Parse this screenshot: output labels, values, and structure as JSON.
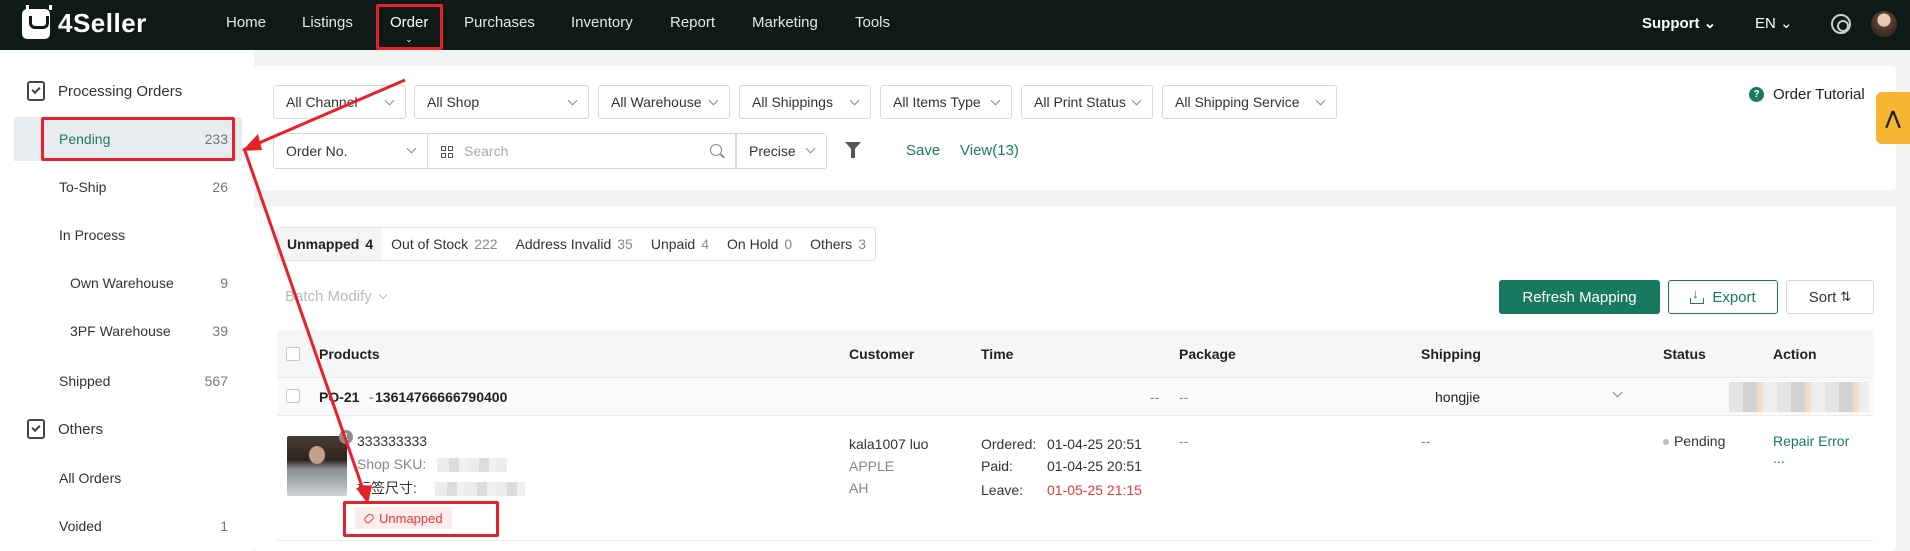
{
  "app": {
    "brand": "4Seller"
  },
  "topnav": {
    "items": [
      "Home",
      "Listings",
      "Order",
      "Purchases",
      "Inventory",
      "Report",
      "Marketing",
      "Tools"
    ],
    "support": "Support",
    "language": "EN"
  },
  "sidebar": {
    "processing_title": "Processing Orders",
    "items": [
      {
        "label": "Pending",
        "count": "233"
      },
      {
        "label": "To-Ship",
        "count": "26"
      },
      {
        "label": "In Process",
        "count": ""
      },
      {
        "label": "Own Warehouse",
        "count": "9"
      },
      {
        "label": "3PF Warehouse",
        "count": "39"
      },
      {
        "label": "Shipped",
        "count": "567"
      }
    ],
    "others_title": "Others",
    "others_items": [
      {
        "label": "All Orders",
        "count": ""
      },
      {
        "label": "Voided",
        "count": "1"
      }
    ]
  },
  "filters": {
    "channel": "All Channel",
    "shop": "All Shop",
    "warehouse": "All Warehouse",
    "shippings": "All Shippings",
    "items_type": "All Items Type",
    "print_status": "All Print Status",
    "shipping_service": "All Shipping Service",
    "order_no": "Order No.",
    "search_placeholder": "Search",
    "precise": "Precise",
    "save": "Save",
    "view": "View(13)",
    "tutorial": "Order Tutorial"
  },
  "tabs": [
    {
      "label": "Unmapped",
      "count": "4"
    },
    {
      "label": "Out of Stock",
      "count": "222"
    },
    {
      "label": "Address Invalid",
      "count": "35"
    },
    {
      "label": "Unpaid",
      "count": "4"
    },
    {
      "label": "On Hold",
      "count": "0"
    },
    {
      "label": "Others",
      "count": "3"
    }
  ],
  "toolbar": {
    "batch_modify": "Batch Modify",
    "refresh_mapping": "Refresh Mapping",
    "export": "Export",
    "sort": "Sort"
  },
  "table": {
    "headers": [
      "Products",
      "Customer",
      "Time",
      "Package",
      "Shipping",
      "Status",
      "Action"
    ],
    "order": {
      "po": "PO-21",
      "order_id": "13614766666790400",
      "dash1": "--",
      "package": "--",
      "carrier": "hongjie"
    },
    "product": {
      "quantity": "1",
      "title": "333333333",
      "shop_sku_label": "Shop SKU:",
      "tag_size_label": "标签尺寸:",
      "unmapped_badge": "Unmapped",
      "customer_name": "kala1007 luo",
      "customer_line2": "APPLE",
      "customer_line3": "AH",
      "ordered_label": "Ordered:",
      "ordered_value": "01-04-25 20:51",
      "paid_label": "Paid:",
      "paid_value": "01-04-25 20:51",
      "leave_label": "Leave:",
      "leave_value": "01-05-25 21:15",
      "package": "--",
      "shipping": "--",
      "status": "Pending",
      "action": "Repair Error",
      "more": "..."
    }
  },
  "colors": {
    "topbar": "#0d1a17",
    "accent": "#177a60",
    "highlight": "#e8202a",
    "danger": "#e53935"
  }
}
